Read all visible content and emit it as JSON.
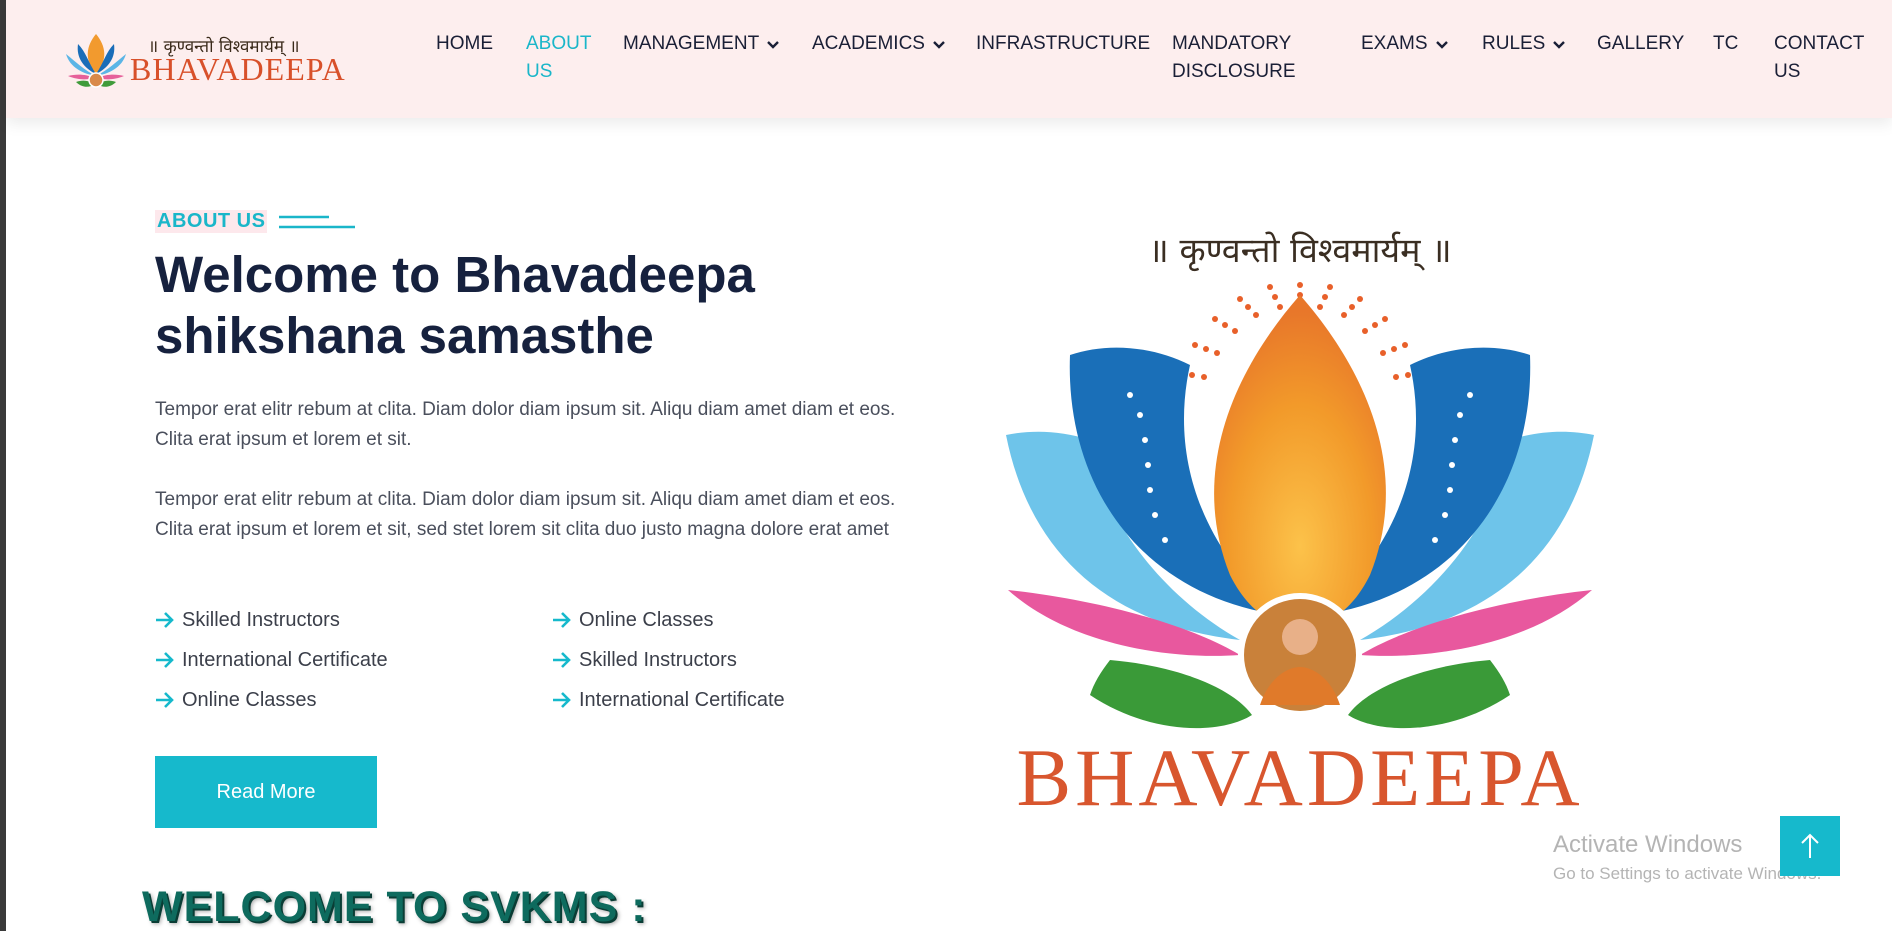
{
  "brand": {
    "motto": "॥ कृण्वन्तो विश्वमार्यम् ॥",
    "name": "BHAVADEEPA"
  },
  "nav": {
    "items": [
      {
        "label_line1": "HOME",
        "label_line2": "",
        "has_caret": false,
        "active": false
      },
      {
        "label_line1": "ABOUT",
        "label_line2": "US",
        "has_caret": false,
        "active": true
      },
      {
        "label_line1": "MANAGEMENT",
        "label_line2": "",
        "has_caret": true,
        "active": false
      },
      {
        "label_line1": "ACADEMICS",
        "label_line2": "",
        "has_caret": true,
        "active": false
      },
      {
        "label_line1": "INFRASTRUCTURE",
        "label_line2": "",
        "has_caret": false,
        "active": false
      },
      {
        "label_line1": "MANDATORY",
        "label_line2": "DISCLOSURE",
        "has_caret": false,
        "active": false
      },
      {
        "label_line1": "EXAMS",
        "label_line2": "",
        "has_caret": true,
        "active": false
      },
      {
        "label_line1": "RULES",
        "label_line2": "",
        "has_caret": true,
        "active": false
      },
      {
        "label_line1": "GALLERY",
        "label_line2": "",
        "has_caret": false,
        "active": false
      },
      {
        "label_line1": "TC",
        "label_line2": "",
        "has_caret": false,
        "active": false
      },
      {
        "label_line1": "CONTACT",
        "label_line2": "US",
        "has_caret": false,
        "active": false
      }
    ]
  },
  "about": {
    "eyebrow": "ABOUT US",
    "title": "Welcome to Bhavadeepa shikshana samasthe",
    "paragraph1": "Tempor erat elitr rebum at clita. Diam dolor diam ipsum sit. Aliqu diam amet diam et eos. Clita erat ipsum et lorem et sit.",
    "paragraph2": "Tempor erat elitr rebum at clita. Diam dolor diam ipsum sit. Aliqu diam amet diam et eos. Clita erat ipsum et lorem et sit, sed stet lorem sit clita duo justo magna dolore erat amet",
    "features_left": [
      "Skilled Instructors",
      "International Certificate",
      "Online Classes"
    ],
    "features_right": [
      "Online Classes",
      "Skilled Instructors",
      "International Certificate"
    ],
    "read_more_label": "Read More"
  },
  "logo_art": {
    "motto": "॥ कृण्वन्तो विश्वमार्यम् ॥",
    "name": "BHAVADEEPA"
  },
  "section_heading": "WELCOME TO SVKMS :",
  "windows_watermark": {
    "title": "Activate Windows",
    "subtitle": "Go to Settings to activate Windows."
  },
  "colors": {
    "accent": "#16b9cc",
    "nav_bg": "#fdeeee",
    "title": "#16213e",
    "brand_orange": "#d8502a"
  },
  "icons": {
    "feature_bullet": "arrow-right-icon",
    "nav_caret": "chevron-down-icon",
    "back_to_top": "arrow-up-icon"
  }
}
